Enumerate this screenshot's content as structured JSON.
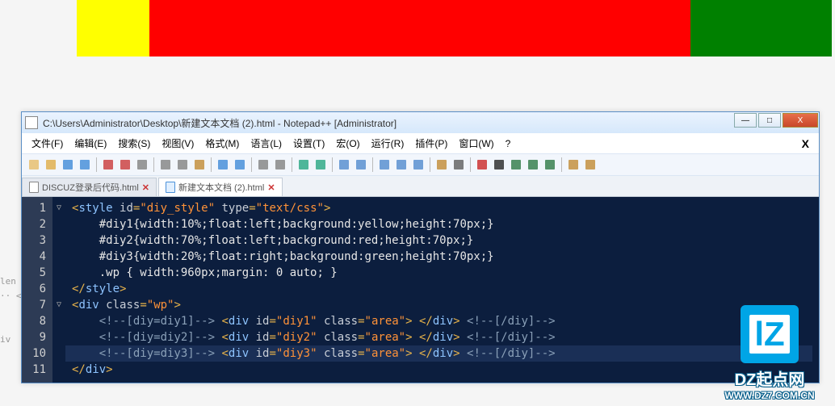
{
  "demo_colors": [
    "#ffff00",
    "#ff0000",
    "#008000"
  ],
  "bg_snippets": [
    "len",
    "·· <",
    "iv"
  ],
  "window": {
    "title": "C:\\Users\\Administrator\\Desktop\\新建文本文档 (2).html - Notepad++ [Administrator]",
    "min": "—",
    "max": "□",
    "close": "X"
  },
  "menus": [
    "文件(F)",
    "编辑(E)",
    "搜索(S)",
    "视图(V)",
    "格式(M)",
    "语言(L)",
    "设置(T)",
    "宏(O)",
    "运行(R)",
    "插件(P)",
    "窗口(W)",
    "?"
  ],
  "menu_x": "X",
  "toolbar_icons": [
    "new-file-icon",
    "open-icon",
    "save-icon",
    "save-all-icon",
    "|",
    "close-icon",
    "close-all-icon",
    "print-icon",
    "|",
    "cut-icon",
    "copy-icon",
    "paste-icon",
    "|",
    "undo-icon",
    "redo-icon",
    "|",
    "find-icon",
    "replace-icon",
    "|",
    "zoom-in-icon",
    "zoom-out-icon",
    "|",
    "sync-v-icon",
    "sync-h-icon",
    "|",
    "wrap-icon",
    "show-all-icon",
    "indent-guide-icon",
    "|",
    "lang-icon",
    "eye-icon",
    "|",
    "record-icon",
    "stop-icon",
    "play-icon",
    "play-multi-icon",
    "fast-icon",
    "|",
    "spell-icon",
    "doc-icon"
  ],
  "tabs": [
    {
      "label": "DISCUZ登录后代码.html",
      "active": false,
      "close": "✕"
    },
    {
      "label": "新建文本文档 (2).html",
      "active": true,
      "close": "✕"
    }
  ],
  "code": {
    "1": {
      "fold": "▽",
      "html": "<span class='t-punc'>&lt;</span><span class='t-tag'>style</span> <span class='t-attr'>id</span><span class='t-punc'>=</span><span class='t-str'>\"diy_style\"</span> <span class='t-attr'>type</span><span class='t-punc'>=</span><span class='t-str'>\"text/css\"</span><span class='t-punc'>&gt;</span>"
    },
    "2": {
      "fold": "",
      "html": "    <span class='t-text'>#diy1{width:10%;float:left;background:yellow;height:70px;}</span>"
    },
    "3": {
      "fold": "",
      "html": "    <span class='t-text'>#diy2{width:70%;float:left;background:red;height:70px;}</span>"
    },
    "4": {
      "fold": "",
      "html": "    <span class='t-text'>#diy3{width:20%;float:right;background:green;height:70px;}</span>"
    },
    "5": {
      "fold": "",
      "html": "    <span class='t-text'>.wp { width:960px;margin: 0 auto; }</span>"
    },
    "6": {
      "fold": "",
      "html": "<span class='t-punc'>&lt;/</span><span class='t-tag'>style</span><span class='t-punc'>&gt;</span>"
    },
    "7": {
      "fold": "▽",
      "html": "<span class='t-punc'>&lt;</span><span class='t-tag'>div</span> <span class='t-attr'>class</span><span class='t-punc'>=</span><span class='t-str'>\"wp\"</span><span class='t-punc'>&gt;</span>"
    },
    "8": {
      "fold": "",
      "html": "    <span class='t-com'>&lt;!--[diy=diy1]--&gt;</span> <span class='t-punc'>&lt;</span><span class='t-tag'>div</span> <span class='t-attr'>id</span><span class='t-punc'>=</span><span class='t-str'>\"diy1\"</span> <span class='t-attr'>class</span><span class='t-punc'>=</span><span class='t-str'>\"area\"</span><span class='t-punc'>&gt;</span> <span class='t-punc'>&lt;/</span><span class='t-tag'>div</span><span class='t-punc'>&gt;</span> <span class='t-com'>&lt;!--[/diy]--&gt;</span>"
    },
    "9": {
      "fold": "",
      "html": "    <span class='t-com'>&lt;!--[diy=diy2]--&gt;</span> <span class='t-punc'>&lt;</span><span class='t-tag'>div</span> <span class='t-attr'>id</span><span class='t-punc'>=</span><span class='t-str'>\"diy2\"</span> <span class='t-attr'>class</span><span class='t-punc'>=</span><span class='t-str'>\"area\"</span><span class='t-punc'>&gt;</span> <span class='t-punc'>&lt;/</span><span class='t-tag'>div</span><span class='t-punc'>&gt;</span> <span class='t-com'>&lt;!--[/diy]--&gt;</span>"
    },
    "10": {
      "fold": "",
      "cursor": true,
      "html": "    <span class='t-com'>&lt;!--[diy=diy3]--&gt;</span> <span class='t-punc'>&lt;</span><span class='t-tag'>div</span> <span class='t-attr'>id</span><span class='t-punc'>=</span><span class='t-str'>\"diy3\"</span> <span class='t-attr'>class</span><span class='t-punc'>=</span><span class='t-str'>\"area\"</span><span class='t-punc'>&gt;</span> <span class='t-punc'>&lt;/</span><span class='t-tag'>div</span><span class='t-punc'>&gt;</span> <span class='t-com'>&lt;!--[/diy]--&gt;</span>"
    },
    "11": {
      "fold": "",
      "html": "<span class='t-punc'>&lt;/</span><span class='t-tag'>div</span><span class='t-punc'>&gt;</span>"
    }
  },
  "line_count": 11,
  "watermark": {
    "logo": "lZ",
    "text1": "DZ起点网",
    "text2": "WWW.DZ7.COM.CN"
  }
}
